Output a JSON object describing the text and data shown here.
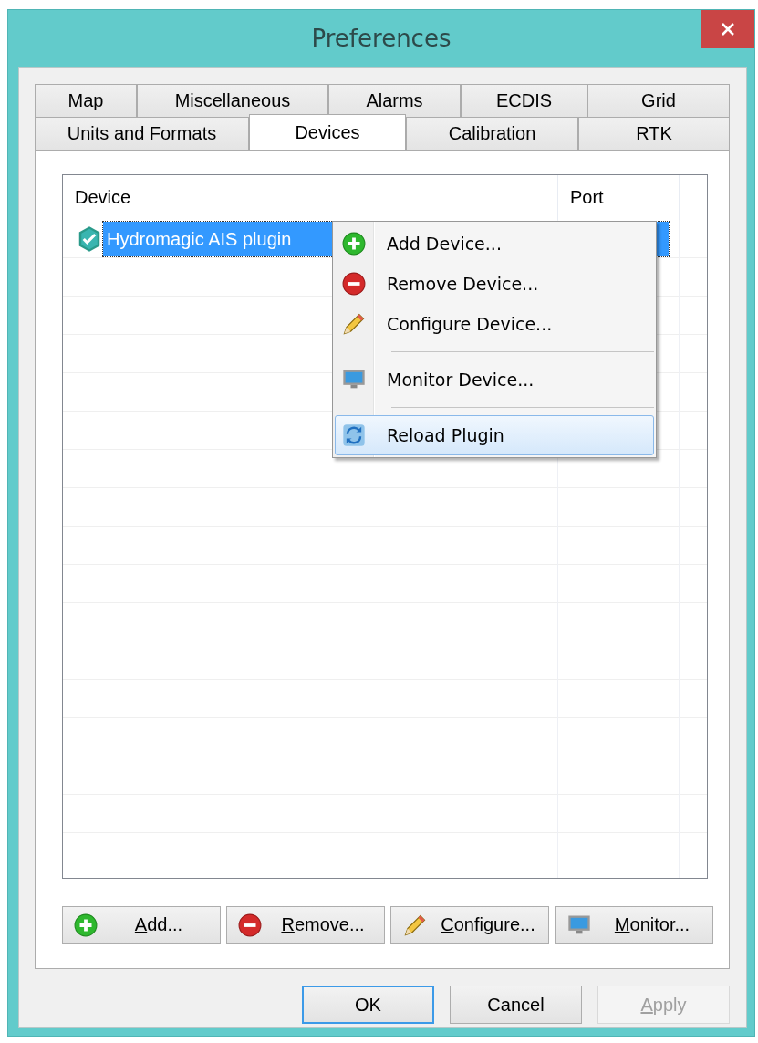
{
  "window": {
    "title": "Preferences"
  },
  "tabs": [
    [
      {
        "label": "Map",
        "selected": false
      },
      {
        "label": "Miscellaneous",
        "selected": false
      },
      {
        "label": "Alarms",
        "selected": false
      },
      {
        "label": "ECDIS",
        "selected": false
      },
      {
        "label": "Grid",
        "selected": false
      }
    ],
    [
      {
        "label": "Units and Formats",
        "selected": false
      },
      {
        "label": "Devices",
        "selected": true
      },
      {
        "label": "Calibration",
        "selected": false
      },
      {
        "label": "RTK",
        "selected": false
      }
    ]
  ],
  "table": {
    "columns": [
      "Device",
      "Port"
    ],
    "rows": [
      {
        "device": "Hydromagic AIS plugin",
        "selected": true
      }
    ]
  },
  "context_menu": [
    {
      "kind": "item",
      "label": "Add Device...",
      "selected": false
    },
    {
      "kind": "item",
      "label": "Remove Device...",
      "selected": false
    },
    {
      "kind": "item",
      "label": "Configure Device...",
      "selected": false
    },
    {
      "kind": "separator"
    },
    {
      "kind": "item",
      "label": "Monitor Device...",
      "selected": false
    },
    {
      "kind": "separator"
    },
    {
      "kind": "item",
      "label": "Reload Plugin",
      "selected": true
    }
  ],
  "device_buttons": [
    {
      "label": "Add...",
      "mnemonic_underlined": true
    },
    {
      "label": "Remove...",
      "mnemonic_underlined": true
    },
    {
      "label": "Configure...",
      "mnemonic_underlined": true
    },
    {
      "label": "Monitor...",
      "mnemonic_underlined": true
    }
  ],
  "dialog_buttons": [
    {
      "label": "OK",
      "default": true,
      "disabled": false,
      "mnemonic_underlined": false
    },
    {
      "label": "Cancel",
      "default": false,
      "disabled": false,
      "mnemonic_underlined": false
    },
    {
      "label": "Apply",
      "default": false,
      "disabled": true,
      "mnemonic_underlined": true
    }
  ]
}
